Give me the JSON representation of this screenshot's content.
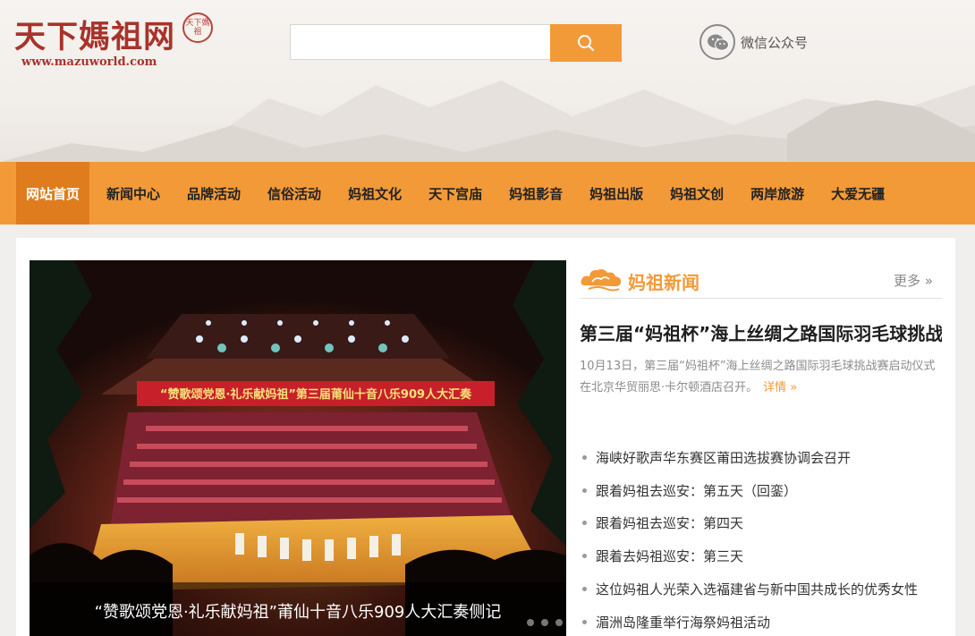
{
  "header": {
    "logo_title": "天下媽祖网",
    "logo_url": "www.mazuworld.com",
    "seal_text": "天下媽祖",
    "search": {
      "value": "",
      "placeholder": ""
    },
    "search_button_icon": "search-icon",
    "wechat": {
      "icon": "wechat-icon",
      "label": "微信公众号"
    }
  },
  "nav": {
    "items": [
      {
        "label": "网站首页",
        "active": true
      },
      {
        "label": "新闻中心"
      },
      {
        "label": "品牌活动"
      },
      {
        "label": "信俗活动"
      },
      {
        "label": "妈祖文化"
      },
      {
        "label": "天下宫庙"
      },
      {
        "label": "妈祖影音"
      },
      {
        "label": "妈祖出版"
      },
      {
        "label": "妈祖文创"
      },
      {
        "label": "两岸旅游"
      },
      {
        "label": "大爱无疆"
      }
    ]
  },
  "slider": {
    "banner_text": "“赞歌颂党恩·礼乐献妈祖”第三届莆仙十音八乐909人大汇奏",
    "caption": "“赞歌颂党恩·礼乐献妈祖”莆仙十音八乐909人大汇奏侧记",
    "dots": 3,
    "active_dot": 0
  },
  "news": {
    "section_title": "妈祖新闻",
    "section_icon": "cloud-icon",
    "more_label": "更多 »",
    "headline": "第三届“妈祖杯”海上丝绸之路国际羽毛球挑战赛启动",
    "summary": "10月13日，第三届“妈祖杯”海上丝绸之路国际羽毛球挑战赛启动仪式在北京华贸丽思·卡尔顿酒店召开。",
    "detail_label": "详情 »",
    "items": [
      "海峡好歌声华东赛区莆田选拔赛协调会召开",
      "跟着妈祖去巡安：第五天（回銮）",
      "跟着妈祖去巡安：第四天",
      "跟着去妈祖巡安：第三天",
      "这位妈祖人光荣入选福建省与新中国共成长的优秀女性",
      "湄洲岛隆重举行海祭妈祖活动"
    ]
  },
  "colors": {
    "accent": "#f29a38",
    "nav_active": "#df7d1e",
    "logo_red": "#a8332a"
  }
}
